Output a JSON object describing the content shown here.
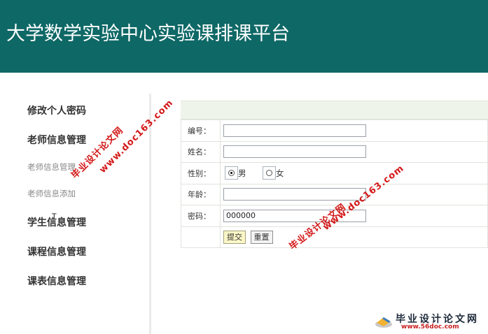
{
  "header": {
    "title": "大学数学实验中心实验课排课平台"
  },
  "sidebar": {
    "items": [
      {
        "label": "修改个人密码"
      },
      {
        "label": "老师信息管理"
      },
      {
        "label": "老师信息管理",
        "sub": true
      },
      {
        "label": "老师信息添加",
        "sub": true
      },
      {
        "label": "学生信息管理"
      },
      {
        "label": "课程信息管理"
      },
      {
        "label": "课表信息管理"
      }
    ]
  },
  "form": {
    "fields": {
      "id_label": "编号：",
      "id_value": "",
      "name_label": "姓名：",
      "name_value": "",
      "gender_label": "性别：",
      "gender_options": [
        "男",
        "女"
      ],
      "gender_selected": "男",
      "age_label": "年龄：",
      "age_value": "",
      "password_label": "密码：",
      "password_value": "000000"
    },
    "submit_label": "提交",
    "reset_label": "重置"
  },
  "watermarks": {
    "site_name": "毕业设计论文网",
    "site_url": "www.doc163.com"
  },
  "logo": {
    "name": "毕业设计论文网",
    "url": "www.56doc.com",
    "icon": "book-logo-icon"
  }
}
